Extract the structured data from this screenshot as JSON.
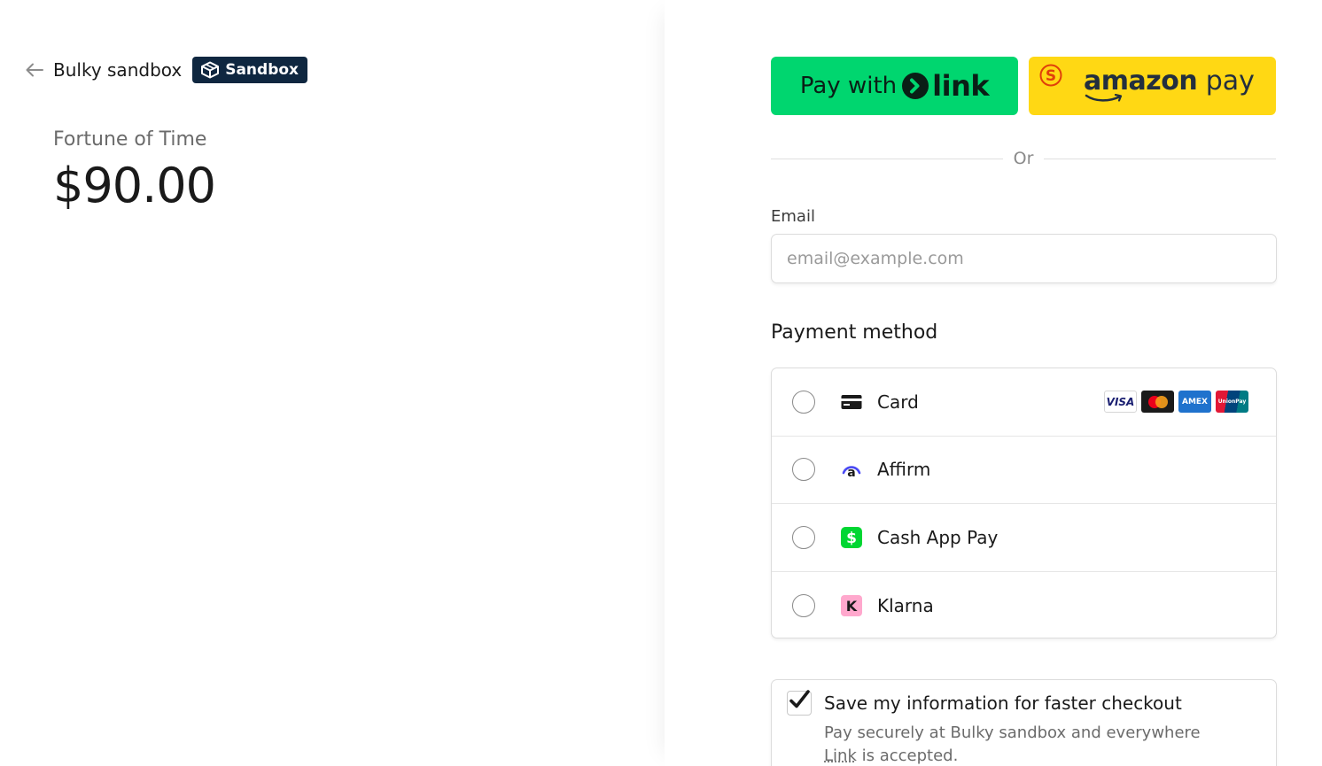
{
  "merchant": {
    "name": "Bulky sandbox",
    "badge_label": "Sandbox"
  },
  "product": {
    "name": "Fortune of Time",
    "price": "$90.00"
  },
  "wallets": {
    "link": {
      "prefix": "Pay with",
      "brand": "link",
      "color": "#00d66f"
    },
    "amazon": {
      "brand_bold": "amazon",
      "brand_light": "pay",
      "color": "#ffd814"
    }
  },
  "divider_text": "Or",
  "email": {
    "label": "Email",
    "placeholder": "email@example.com",
    "value": ""
  },
  "payment_method": {
    "title": "Payment method",
    "options": [
      {
        "label": "Card",
        "icon": "card-icon"
      },
      {
        "label": "Affirm",
        "icon": "affirm-icon"
      },
      {
        "label": "Cash App Pay",
        "icon": "cash-app-icon"
      },
      {
        "label": "Klarna",
        "icon": "klarna-icon"
      }
    ],
    "card_brands": [
      "VISA",
      "mastercard",
      "AMEX",
      "UnionPay"
    ]
  },
  "save_info": {
    "checked": true,
    "title": "Save my information for faster checkout",
    "desc_before": "Pay securely at Bulky sandbox and everywhere ",
    "desc_link": "Link",
    "desc_after": " is accepted."
  }
}
